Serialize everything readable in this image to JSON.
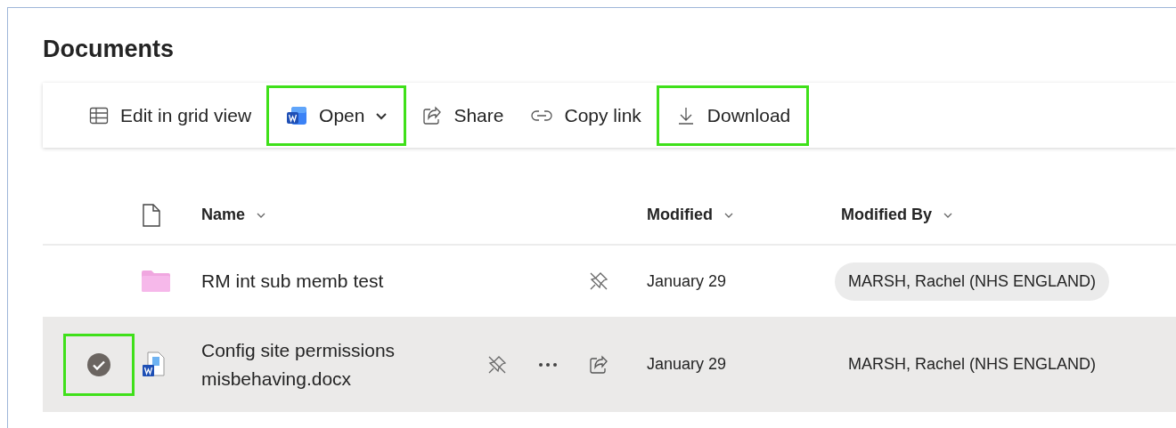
{
  "title": "Documents",
  "toolbar": [
    {
      "kind": "grid",
      "label": "Edit in grid view",
      "highlighted": false
    },
    {
      "kind": "open",
      "label": "Open",
      "highlighted": true
    },
    {
      "kind": "share",
      "label": "Share",
      "highlighted": false
    },
    {
      "kind": "link",
      "label": "Copy link",
      "highlighted": false
    },
    {
      "kind": "download",
      "label": "Download",
      "highlighted": true
    }
  ],
  "columns": [
    {
      "label": "Name"
    },
    {
      "label": "Modified"
    },
    {
      "label": "Modified By"
    }
  ],
  "rows": [
    {
      "kind": "folder",
      "name": "RM int sub memb test",
      "selected": false,
      "check_highlighted": false,
      "actions": [
        {
          "kind": "pin"
        }
      ],
      "modified": "January 29",
      "modified_by": "MARSH, Rachel (NHS ENGLAND)",
      "modified_by_pill": true
    },
    {
      "kind": "docx",
      "name": "Config site permissions misbehaving.docx",
      "selected": true,
      "check_highlighted": true,
      "actions": [
        {
          "kind": "pin"
        },
        {
          "kind": "more"
        },
        {
          "kind": "share"
        }
      ],
      "modified": "January 29",
      "modified_by": "MARSH, Rachel (NHS ENGLAND)",
      "modified_by_pill": false
    }
  ]
}
